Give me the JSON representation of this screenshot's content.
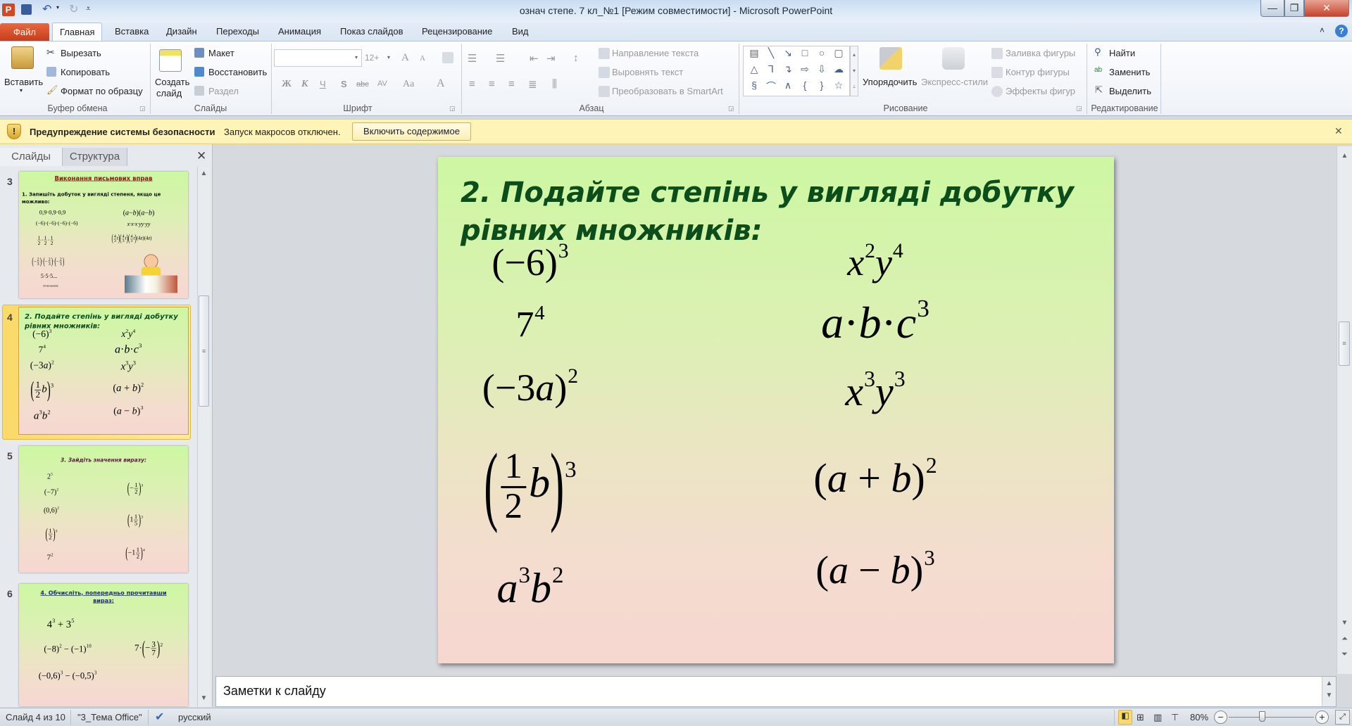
{
  "window": {
    "title": "означ степе. 7 кл_№1 [Режим совместимости]  -  Microsoft PowerPoint",
    "minimize": "—",
    "restore": "❐",
    "close": "✕"
  },
  "tabs": {
    "file": "Файл",
    "items": [
      "Главная",
      "Вставка",
      "Дизайн",
      "Переходы",
      "Анимация",
      "Показ слайдов",
      "Рецензирование",
      "Вид"
    ],
    "selected": "Главная"
  },
  "ribbon": {
    "clipboard": {
      "label": "Буфер обмена",
      "paste": "Вставить",
      "cut": "Вырезать",
      "copy": "Копировать",
      "format_painter": "Формат по образцу"
    },
    "slides": {
      "label": "Слайды",
      "new_slide_1": "Создать",
      "new_slide_2": "слайд",
      "layout": "Макет",
      "reset": "Восстановить",
      "section": "Раздел"
    },
    "font": {
      "label": "Шрифт",
      "font_name": "",
      "font_size": "12+",
      "grow": "A",
      "shrink": "A",
      "bold": "Ж",
      "italic": "К",
      "underline": "Ч",
      "shadow": "S",
      "strike": "abc",
      "spacing": "AV",
      "case": "Aa",
      "color": "A"
    },
    "paragraph": {
      "label": "Абзац",
      "text_direction": "Направление текста",
      "align_text": "Выровнять текст",
      "smartart": "Преобразовать в SmartArt"
    },
    "drawing": {
      "label": "Рисование",
      "arrange": "Упорядочить",
      "quick_styles": "Экспресс-стили",
      "fill": "Заливка фигуры",
      "outline": "Контур фигуры",
      "effects": "Эффекты фигур",
      "shapes": [
        "▤",
        "╲",
        "↘",
        "□",
        "○",
        "▢",
        "△",
        "⅂",
        "↴",
        "⇨",
        "⇩",
        "☁",
        "§",
        "⌒",
        "∧",
        "{",
        "}",
        "☆"
      ]
    },
    "editing": {
      "label": "Редактирование",
      "find": "Найти",
      "replace": "Заменить",
      "select": "Выделить"
    }
  },
  "security_bar": {
    "title": "Предупреждение системы безопасности",
    "message": "Запуск макросов отключен.",
    "button": "Включить содержимое",
    "close": "✕"
  },
  "pane": {
    "tabs": [
      "Слайды",
      "Структура"
    ],
    "close": "✕"
  },
  "slides": [
    {
      "number": "3",
      "title": "Виконання  письмових  вправ",
      "subtitle": "1. Запишіть добуток у вигляді степеня, якщо це можливо:",
      "footnote": "25 множників",
      "items": [
        [
          {
            "t": "0,9·0,9·0,9"
          }
        ],
        [
          {
            "t": "(−6)·(−6)·(−6)·(−6)"
          }
        ],
        [
          {
            "f": [
              "1",
              "2"
            ]
          },
          {
            "t": "·"
          },
          {
            "f": [
              "1",
              "2"
            ]
          },
          {
            "t": "·"
          },
          {
            "f": [
              "1",
              "2"
            ]
          }
        ],
        [
          {
            "b": "("
          },
          {
            "t": "−"
          },
          {
            "f": [
              "2",
              "3"
            ]
          },
          {
            "b": ")"
          },
          {
            "t": "·"
          },
          {
            "b": "("
          },
          {
            "t": "−"
          },
          {
            "f": [
              "2",
              "3"
            ]
          },
          {
            "b": ")"
          },
          {
            "t": "·"
          },
          {
            "b": "("
          },
          {
            "t": "−"
          },
          {
            "f": [
              "2",
              "3"
            ]
          },
          {
            "b": ")"
          }
        ],
        [
          {
            "t": "5·5·5..."
          }
        ],
        [
          {
            "t": "("
          },
          {
            "v": "a"
          },
          {
            "t": "−"
          },
          {
            "v": "b"
          },
          {
            "t": ")("
          },
          {
            "v": "a"
          },
          {
            "t": "−"
          },
          {
            "v": "b"
          },
          {
            "t": ")"
          }
        ],
        [
          {
            "v": "x·x·x·yy·yy"
          }
        ],
        [
          {
            "b": "("
          },
          {
            "f": [
              "4",
              "3"
            ]
          },
          {
            "v": "t"
          },
          {
            "b": ")"
          },
          {
            "b": "("
          },
          {
            "f": [
              "4",
              "3"
            ]
          },
          {
            "v": "t"
          },
          {
            "b": ")"
          },
          {
            "b": "("
          },
          {
            "f": [
              "4",
              "3"
            ]
          },
          {
            "v": "t"
          },
          {
            "b": ")"
          },
          {
            "t": "(4"
          },
          {
            "v": "z"
          },
          {
            "t": ")(4"
          },
          {
            "v": "z"
          },
          {
            "t": ")"
          }
        ]
      ]
    },
    {
      "number": "4",
      "title": "2. Подайте степінь у вигляді добутку рівних множників:",
      "items": [
        [
          {
            "t": "(−6)"
          },
          {
            "s": "3"
          }
        ],
        [
          {
            "t": "7"
          },
          {
            "s": "4"
          }
        ],
        [
          {
            "t": "(−3"
          },
          {
            "v": "a"
          },
          {
            "t": ")"
          },
          {
            "s": "2"
          }
        ],
        [
          {
            "b": "("
          },
          {
            "f": [
              "1",
              "2"
            ]
          },
          {
            "v": "b"
          },
          {
            "b": ")"
          },
          {
            "s": "3"
          }
        ],
        [
          {
            "v": "a"
          },
          {
            "s": "3"
          },
          {
            "v": "b"
          },
          {
            "s": "2"
          }
        ],
        [
          {
            "v": "x"
          },
          {
            "s": "2"
          },
          {
            "v": "y"
          },
          {
            "s": "4"
          }
        ],
        [
          {
            "v": "a"
          },
          {
            "t": "·"
          },
          {
            "v": "b"
          },
          {
            "t": "·"
          },
          {
            "v": "c"
          },
          {
            "s": "3"
          }
        ],
        [
          {
            "v": "x"
          },
          {
            "s": "3"
          },
          {
            "v": "y"
          },
          {
            "s": "3"
          }
        ],
        [
          {
            "t": "("
          },
          {
            "v": "a"
          },
          {
            "t": " + "
          },
          {
            "v": "b"
          },
          {
            "t": ")"
          },
          {
            "s": "2"
          }
        ],
        [
          {
            "t": "("
          },
          {
            "v": "a"
          },
          {
            "t": " − "
          },
          {
            "v": "b"
          },
          {
            "t": ")"
          },
          {
            "s": "3"
          }
        ]
      ]
    },
    {
      "number": "5",
      "title": "3. Зайдіть значення  виразу:",
      "items": [
        [
          {
            "t": "2"
          },
          {
            "s": "5"
          }
        ],
        [
          {
            "t": "(−7)"
          },
          {
            "s": "2"
          }
        ],
        [
          {
            "t": "(0,6)"
          },
          {
            "s": "2"
          }
        ],
        [
          {
            "b": "("
          },
          {
            "f": [
              "1",
              "2"
            ]
          },
          {
            "b": ")"
          },
          {
            "s": "3"
          }
        ],
        [
          {
            "t": "7"
          },
          {
            "s": "2"
          }
        ],
        [
          {
            "b": "("
          },
          {
            "t": "−"
          },
          {
            "f": [
              "1",
              "2"
            ]
          },
          {
            "b": ")"
          },
          {
            "s": "3"
          }
        ],
        [
          {
            "b": "("
          },
          {
            "t": "1"
          },
          {
            "f": [
              "1",
              "5"
            ]
          },
          {
            "b": ")"
          },
          {
            "s": "3"
          }
        ],
        [
          {
            "b": "("
          },
          {
            "t": "−1"
          },
          {
            "f": [
              "1",
              "2"
            ]
          },
          {
            "b": ")"
          },
          {
            "s": "4"
          }
        ]
      ]
    },
    {
      "number": "6",
      "title": "4. Обчисліть,  попередньо  прочитавши вираз:",
      "items": [
        [
          {
            "t": "4"
          },
          {
            "s": "3"
          },
          {
            "t": " + 3"
          },
          {
            "s": "5"
          }
        ],
        [
          {
            "t": "(−8)"
          },
          {
            "s": "2"
          },
          {
            "t": " − (−1)"
          },
          {
            "s": "10"
          }
        ],
        [
          {
            "t": "7·"
          },
          {
            "b": "("
          },
          {
            "t": "−"
          },
          {
            "f": [
              "3",
              "7"
            ]
          },
          {
            "b": ")"
          },
          {
            "s": "2"
          }
        ],
        [
          {
            "t": "(−0,6)"
          },
          {
            "s": "3"
          },
          {
            "t": " − (−0,5)"
          },
          {
            "s": "3"
          }
        ]
      ]
    }
  ],
  "current_slide_index": 1,
  "notes": {
    "placeholder": "Заметки к слайду"
  },
  "status": {
    "slide": "Слайд 4 из 10",
    "theme": "\"3_Тема Office\"",
    "language": "русский",
    "zoom": "80%",
    "zoom_value": 80
  },
  "colors": {
    "file_tab": "#d24726",
    "title_green": "#0b4d1b",
    "slide3_title": "#8b1a1a",
    "slide5_title": "#5a1e3c",
    "slide6_title": "#1f2f6f",
    "selection": "#fbd96a"
  }
}
